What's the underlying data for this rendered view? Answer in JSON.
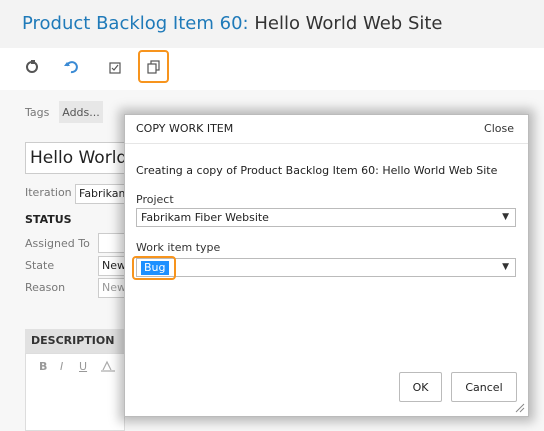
{
  "header": {
    "title_prefix": "Product Backlog Item 60:",
    "title_name": "Hello World Web Site"
  },
  "toolbar": {
    "icons": [
      "refresh-icon",
      "undo-icon",
      "attachment-icon",
      "copy-icon"
    ]
  },
  "form": {
    "tags_label": "Tags",
    "tags_add": "Adds...",
    "title_value": "Hello World",
    "iteration_label": "Iteration",
    "iteration_value": "Fabrikam",
    "status_heading": "STATUS",
    "assigned_label": "Assigned To",
    "state_label": "State",
    "state_value": "New",
    "reason_label": "Reason",
    "reason_value": "New",
    "description_heading": "DESCRIPTION",
    "format_buttons": [
      "B",
      "I",
      "U"
    ]
  },
  "dialog": {
    "title": "COPY WORK ITEM",
    "close": "Close",
    "message": "Creating a copy of Product Backlog Item 60: Hello World Web Site",
    "project_label": "Project",
    "project_value": "Fabrikam Fiber Website",
    "type_label": "Work item type",
    "type_value": "Bug",
    "ok": "OK",
    "cancel": "Cancel"
  },
  "colors": {
    "highlight": "#f7941d",
    "title_accent": "#1f7ab9",
    "selection": "#1e90ff"
  }
}
